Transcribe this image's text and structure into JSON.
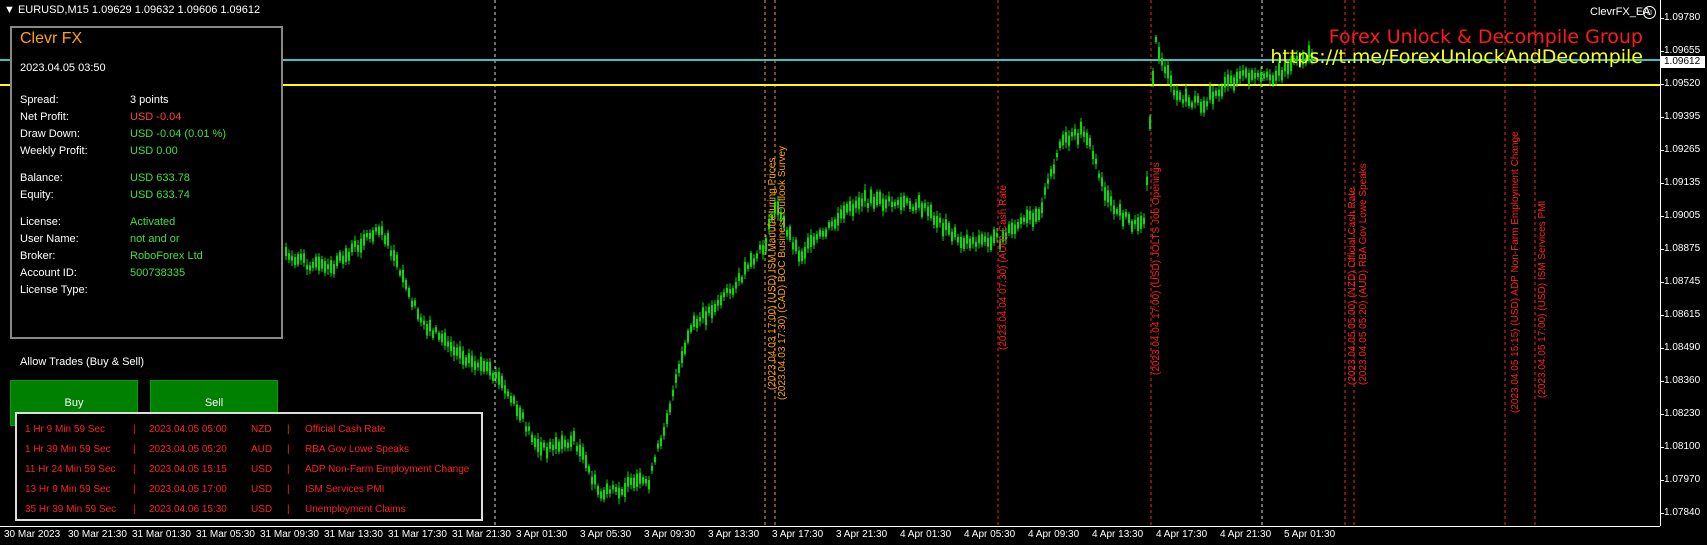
{
  "symbol_info": "EURUSD,M15  1.09629 1.09632 1.09606 1.09612",
  "ea_name": "ClevrFX_EA",
  "promo": {
    "line1": "Forex Unlock & Decompile Group",
    "line2": "https://t.me/ForexUnlockAndDecompile"
  },
  "price_axis": {
    "labels": [
      "1.09780",
      "1.09655",
      "1.09520",
      "1.09395",
      "1.09265",
      "1.09135",
      "1.09005",
      "1.08875",
      "1.08745",
      "1.08615",
      "1.08490",
      "1.08360",
      "1.08230",
      "1.08100",
      "1.07970",
      "1.07840"
    ],
    "current_price": "1.09612"
  },
  "time_axis": [
    "30 Mar 2023",
    "30 Mar 21:30",
    "31 Mar 01:30",
    "31 Mar 05:30",
    "31 Mar 09:30",
    "31 Mar 13:30",
    "31 Mar 17:30",
    "31 Mar 21:30",
    "3 Apr 01:30",
    "3 Apr 05:30",
    "3 Apr 09:30",
    "3 Apr 13:30",
    "3 Apr 17:30",
    "3 Apr 21:30",
    "4 Apr 01:30",
    "4 Apr 05:30",
    "4 Apr 09:30",
    "4 Apr 13:30",
    "4 Apr 17:30",
    "4 Apr 21:30",
    "5 Apr 01:30"
  ],
  "panel": {
    "title": "Clevr FX",
    "datetime": "2023.04.05 03:50",
    "rows": [
      {
        "label": "Spread:",
        "value": "3 points",
        "color": "#ffffff"
      },
      {
        "label": "Net Profit:",
        "value": "USD -0.04",
        "color": "#ff4040"
      },
      {
        "label": "Draw Down:",
        "value": "USD -0.04 (0.01 %)",
        "color": "#40e040"
      },
      {
        "label": "Weekly Profit:",
        "value": "USD 0.00",
        "color": "#40e040"
      },
      {
        "label": "Balance:",
        "value": "USD 633.78",
        "color": "#40e040"
      },
      {
        "label": "Equity:",
        "value": "USD 633.74",
        "color": "#40e040"
      },
      {
        "label": "License:",
        "value": "Activated",
        "color": "#40e040"
      },
      {
        "label": "User Name:",
        "value": "not and or",
        "color": "#40e040"
      },
      {
        "label": "Broker:",
        "value": "RoboForex Ltd",
        "color": "#40e040"
      },
      {
        "label": "Account ID:",
        "value": "500738335",
        "color": "#40e040"
      },
      {
        "label": "License Type:",
        "value": "",
        "color": "#40e040"
      }
    ]
  },
  "trade": {
    "allow_label": "Allow Trades (Buy & Sell)",
    "buy_label": "Buy",
    "sell_label": "Sell"
  },
  "news": [
    {
      "countdown": "1 Hr 9 Min 59 Sec",
      "sep": "|",
      "time": "2023.04.05 05:00",
      "currency": "NZD",
      "event": "Official Cash Rate"
    },
    {
      "countdown": "1 Hr 39 Min 59 Sec",
      "sep": "|",
      "time": "2023.04.05 05:20",
      "currency": "AUD",
      "event": "RBA Gov Lowe Speaks"
    },
    {
      "countdown": "11 Hr 24 Min 59 Sec",
      "sep": "|",
      "time": "2023.04.05 15:15",
      "currency": "USD",
      "event": "ADP Non-Farm Employment Change"
    },
    {
      "countdown": "13 Hr 9 Min 59 Sec",
      "sep": "|",
      "time": "2023.04.05 17:00",
      "currency": "USD",
      "event": "ISM Services PMI"
    },
    {
      "countdown": "35 Hr 39 Min 59 Sec",
      "sep": "|",
      "time": "2023.04.06 15:30",
      "currency": "USD",
      "event": "Unemployment Claims"
    }
  ],
  "event_markers": [
    {
      "text": "(2023.04.03 17:00) (USD) ISM Manufacturing Prices",
      "color": "#ffa500"
    },
    {
      "text": "(2023.04.03 17:30) (CAD) BOC Business Outlook Survey",
      "color": "#ffa500"
    },
    {
      "text": "(2023.04.04 07:30) (AUD) Cash Rate",
      "color": "#ff2020"
    },
    {
      "text": "(2023.04.04 17:00) (USD) JOLTS Job Openings",
      "color": "#ff2020"
    },
    {
      "text": "(2023.04.05 05:00) (NZD) Official Cash Rate",
      "color": "#ff2020"
    },
    {
      "text": "(2023.04.05 05:20) (AUD) RBA Gov Lowe Speaks",
      "color": "#ff2020"
    },
    {
      "text": "(2023.04.05 15:15) (USD) ADP Non-Farm Employment Change",
      "color": "#ff2020"
    },
    {
      "text": "(2023.04.05 17:00) (USD) ISM Services PMI",
      "color": "#ff2020"
    }
  ],
  "colors": {
    "candle": "#00e000",
    "yellow_line": "#ffff00",
    "cyan_line": "#40c0c0",
    "grid": "#ffffff"
  }
}
